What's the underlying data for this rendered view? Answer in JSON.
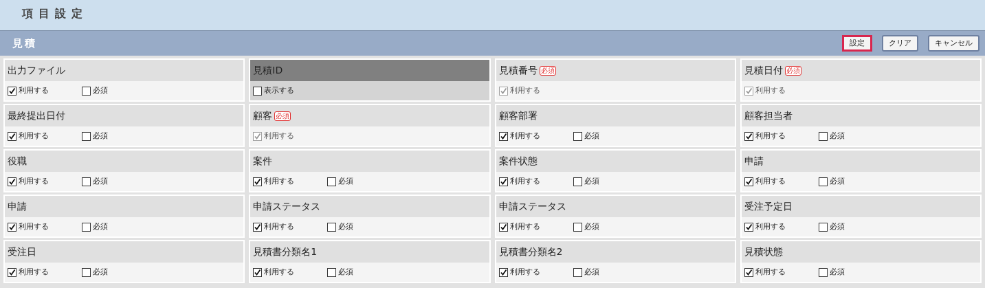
{
  "page_title": "項目設定",
  "section": {
    "title": "見積",
    "buttons": [
      {
        "label": "設定",
        "highlighted": true
      },
      {
        "label": "クリア",
        "highlighted": false
      },
      {
        "label": "キャンセル",
        "highlighted": false
      }
    ]
  },
  "fields": [
    {
      "kind": "normal",
      "label": "出力ファイル",
      "options": [
        {
          "label": "利用する",
          "checked": true,
          "disabled": false
        },
        {
          "label": "必須",
          "checked": false,
          "disabled": false
        }
      ]
    },
    {
      "kind": "system",
      "label": "見積ID",
      "options": [
        {
          "label": "表示する",
          "checked": false,
          "disabled": false
        }
      ]
    },
    {
      "kind": "normal",
      "label": "見積番号",
      "badge": "必須",
      "options": [
        {
          "label": "利用する",
          "checked": true,
          "disabled": true
        }
      ]
    },
    {
      "kind": "normal",
      "label": "見積日付",
      "badge": "必須",
      "options": [
        {
          "label": "利用する",
          "checked": true,
          "disabled": true
        }
      ]
    },
    {
      "kind": "normal",
      "label": "最終提出日付",
      "options": [
        {
          "label": "利用する",
          "checked": true,
          "disabled": false
        },
        {
          "label": "必須",
          "checked": false,
          "disabled": false
        }
      ]
    },
    {
      "kind": "normal",
      "label": "顧客",
      "badge": "必須",
      "options": [
        {
          "label": "利用する",
          "checked": true,
          "disabled": true
        }
      ]
    },
    {
      "kind": "normal",
      "label": "顧客部署",
      "options": [
        {
          "label": "利用する",
          "checked": true,
          "disabled": false
        },
        {
          "label": "必須",
          "checked": false,
          "disabled": false
        }
      ]
    },
    {
      "kind": "normal",
      "label": "顧客担当者",
      "options": [
        {
          "label": "利用する",
          "checked": true,
          "disabled": false
        },
        {
          "label": "必須",
          "checked": false,
          "disabled": false
        }
      ]
    },
    {
      "kind": "normal",
      "label": "役職",
      "options": [
        {
          "label": "利用する",
          "checked": true,
          "disabled": false
        },
        {
          "label": "必須",
          "checked": false,
          "disabled": false
        }
      ]
    },
    {
      "kind": "normal",
      "label": "案件",
      "options": [
        {
          "label": "利用する",
          "checked": true,
          "disabled": false
        },
        {
          "label": "必須",
          "checked": false,
          "disabled": false
        }
      ]
    },
    {
      "kind": "normal",
      "label": "案件状態",
      "options": [
        {
          "label": "利用する",
          "checked": true,
          "disabled": false
        },
        {
          "label": "必須",
          "checked": false,
          "disabled": false
        }
      ]
    },
    {
      "kind": "normal",
      "label": "申請",
      "options": [
        {
          "label": "利用する",
          "checked": true,
          "disabled": false
        },
        {
          "label": "必須",
          "checked": false,
          "disabled": false
        }
      ]
    },
    {
      "kind": "normal",
      "label": "申請",
      "options": [
        {
          "label": "利用する",
          "checked": true,
          "disabled": false
        },
        {
          "label": "必須",
          "checked": false,
          "disabled": false
        }
      ]
    },
    {
      "kind": "normal",
      "label": "申請ステータス",
      "options": [
        {
          "label": "利用する",
          "checked": true,
          "disabled": false
        },
        {
          "label": "必須",
          "checked": false,
          "disabled": false
        }
      ]
    },
    {
      "kind": "normal",
      "label": "申請ステータス",
      "options": [
        {
          "label": "利用する",
          "checked": true,
          "disabled": false
        },
        {
          "label": "必須",
          "checked": false,
          "disabled": false
        }
      ]
    },
    {
      "kind": "normal",
      "label": "受注予定日",
      "options": [
        {
          "label": "利用する",
          "checked": true,
          "disabled": false
        },
        {
          "label": "必須",
          "checked": false,
          "disabled": false
        }
      ]
    },
    {
      "kind": "normal",
      "label": "受注日",
      "options": [
        {
          "label": "利用する",
          "checked": true,
          "disabled": false
        },
        {
          "label": "必須",
          "checked": false,
          "disabled": false
        }
      ]
    },
    {
      "kind": "normal",
      "label": "見積書分類名1",
      "options": [
        {
          "label": "利用する",
          "checked": true,
          "disabled": false
        },
        {
          "label": "必須",
          "checked": false,
          "disabled": false
        }
      ]
    },
    {
      "kind": "normal",
      "label": "見積書分類名2",
      "options": [
        {
          "label": "利用する",
          "checked": true,
          "disabled": false
        },
        {
          "label": "必須",
          "checked": false,
          "disabled": false
        }
      ]
    },
    {
      "kind": "normal",
      "label": "見積状態",
      "options": [
        {
          "label": "利用する",
          "checked": true,
          "disabled": false
        },
        {
          "label": "必須",
          "checked": false,
          "disabled": false
        }
      ]
    }
  ]
}
